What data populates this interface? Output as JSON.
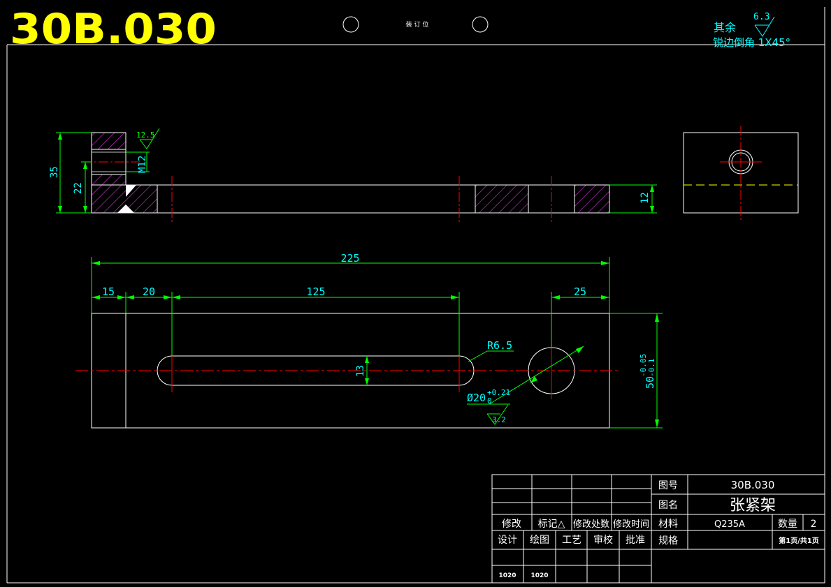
{
  "header": {
    "drawing_code": "30B.030",
    "binding_label": "装 订 位"
  },
  "surface_note": {
    "rest_label": "其余",
    "roughness": "6.3",
    "chamfer_note": "锐边倒角 1X45°"
  },
  "side_view": {
    "roughness": "12.5",
    "thread": "M12",
    "dims": {
      "total_height": "35",
      "partial_height": "22",
      "thickness": "12"
    }
  },
  "top_view": {
    "dims": {
      "overall_length": "225",
      "left_edge": "15",
      "slot_offset": "20",
      "slot_length": "125",
      "hole_offset": "25",
      "slot_width": "13",
      "slot_radius": "R6.5",
      "hole_dia": "Ø20",
      "hole_tol_upper": "+0.21",
      "hole_tol_lower": "0",
      "hole_roughness": "3.2",
      "width": "50",
      "width_tol_upper": "-0.05",
      "width_tol_lower": "-0.1"
    }
  },
  "title_block": {
    "rev_headers": [
      "修改",
      "标记△",
      "修改处数",
      "修改时间"
    ],
    "sign_headers": [
      "设计",
      "绘图",
      "工艺",
      "审校",
      "批准"
    ],
    "sign_values": [
      "1020",
      "1020"
    ],
    "drawing_no_label": "图号",
    "drawing_no": "30B.030",
    "name_label": "图名",
    "name": "张紧架",
    "material_label": "材料",
    "material": "Q235A",
    "qty_label": "数量",
    "qty": "2",
    "spec_label": "规格",
    "sheet": "第1页/共1页"
  }
}
